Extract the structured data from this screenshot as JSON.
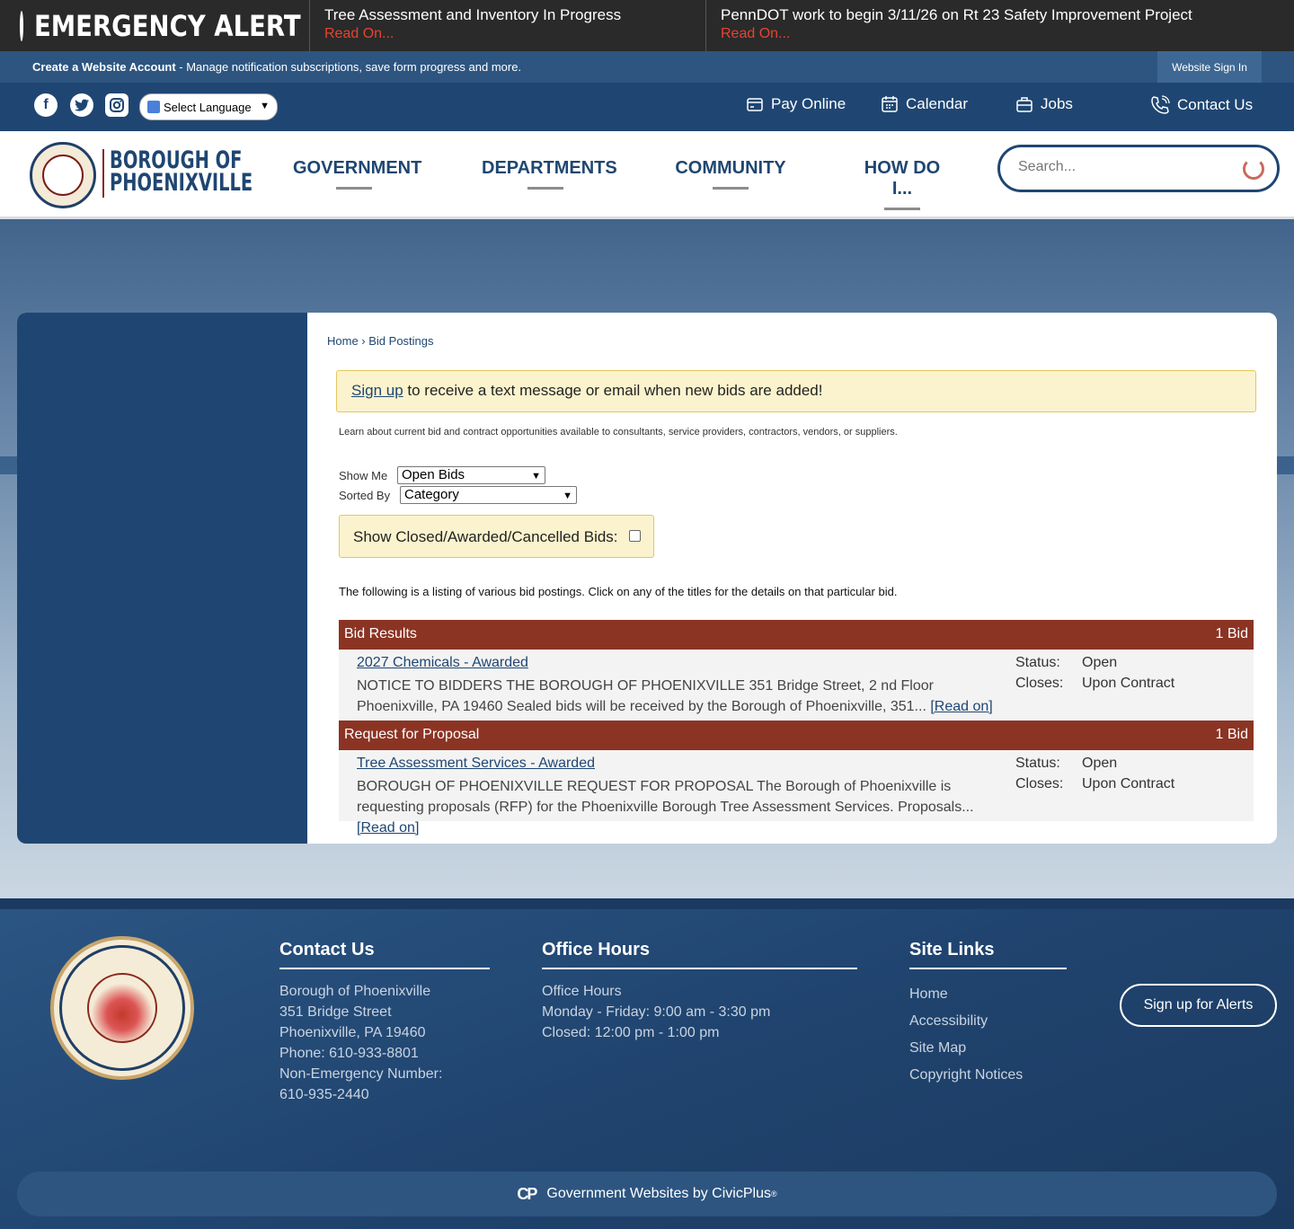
{
  "alert": {
    "title": "EMERGENCY ALERT",
    "items": [
      {
        "headline": "Tree Assessment and Inventory In Progress",
        "more": "Read On..."
      },
      {
        "headline": "PennDOT work to begin 3/11/26 on Rt 23 Safety Improvement Project",
        "more": "Read On..."
      }
    ]
  },
  "account": {
    "create": "Create a Website Account",
    "desc": " - Manage notification subscriptions, save form progress and more.",
    "signin": "Website Sign In"
  },
  "util": {
    "language": "Select Language",
    "links": [
      "Pay Online",
      "Calendar",
      "Jobs",
      "Contact Us"
    ],
    "social": [
      "facebook-icon",
      "twitter-icon",
      "instagram-icon"
    ]
  },
  "header": {
    "logo_line1": "BOROUGH OF",
    "logo_line2": "PHOENIXVILLE",
    "nav": [
      "GOVERNMENT",
      "DEPARTMENTS",
      "COMMUNITY",
      "HOW DO I..."
    ],
    "search_placeholder": "Search..."
  },
  "main": {
    "breadcrumb_home": "Home",
    "breadcrumb_sep": " › ",
    "breadcrumb_current": "Bid Postings",
    "signup_link": "Sign up",
    "signup_text": " to receive a text message or email when new bids are added!",
    "learn": "Learn about current bid and contract opportunities available to consultants, service providers, contractors, vendors, or suppliers.",
    "show_me_label": "Show Me",
    "show_me_value": "Open Bids",
    "sorted_by_label": "Sorted By",
    "sorted_by_value": "Category",
    "closed_label": "Show Closed/Awarded/Cancelled Bids:",
    "following": "The following is a listing of various bid postings. Click on any of the titles for the details on that particular bid.",
    "status_label": "Status:",
    "closes_label": "Closes:",
    "categories": [
      {
        "name": "Bid Results",
        "count": "1 Bid",
        "bid": {
          "title": "2027 Chemicals - Awarded",
          "desc": "NOTICE TO BIDDERS THE BOROUGH OF PHOENIXVILLE 351 Bridge Street, 2 nd Floor Phoenixville, PA 19460 Sealed bids will be received by the Borough of Phoenixville, 351... ",
          "read_on": "[Read on]",
          "status": "Open",
          "closes": "Upon Contract"
        }
      },
      {
        "name": "Request for Proposal",
        "count": "1 Bid",
        "bid": {
          "title": "Tree Assessment Services - Awarded",
          "desc": "BOROUGH OF PHOENIXVILLE REQUEST FOR PROPOSAL The Borough of Phoenixville is requesting proposals (RFP) for the Phoenixville Borough Tree Assessment Services. Proposals... ",
          "read_on": "[Read on]",
          "status": "Open",
          "closes": "Upon Contract"
        }
      }
    ]
  },
  "footer": {
    "contact_heading": "Contact Us",
    "contact_lines": [
      "Borough of Phoenixville",
      "351 Bridge Street",
      "Phoenixville, PA 19460",
      "Phone: 610-933-8801",
      "Non-Emergency Number:",
      "610-935-2440"
    ],
    "hours_heading": "Office Hours",
    "hours_lines": [
      "Office Hours",
      "Monday - Friday: 9:00 am - 3:30 pm",
      "Closed: 12:00 pm - 1:00 pm"
    ],
    "links_heading": "Site Links",
    "links": [
      "Home",
      "Accessibility",
      "Site Map",
      "Copyright Notices"
    ],
    "alerts_button": "Sign up for Alerts",
    "civic_logo": "CP",
    "civic_text": "Government Websites by CivicPlus",
    "civic_reg": "®"
  }
}
